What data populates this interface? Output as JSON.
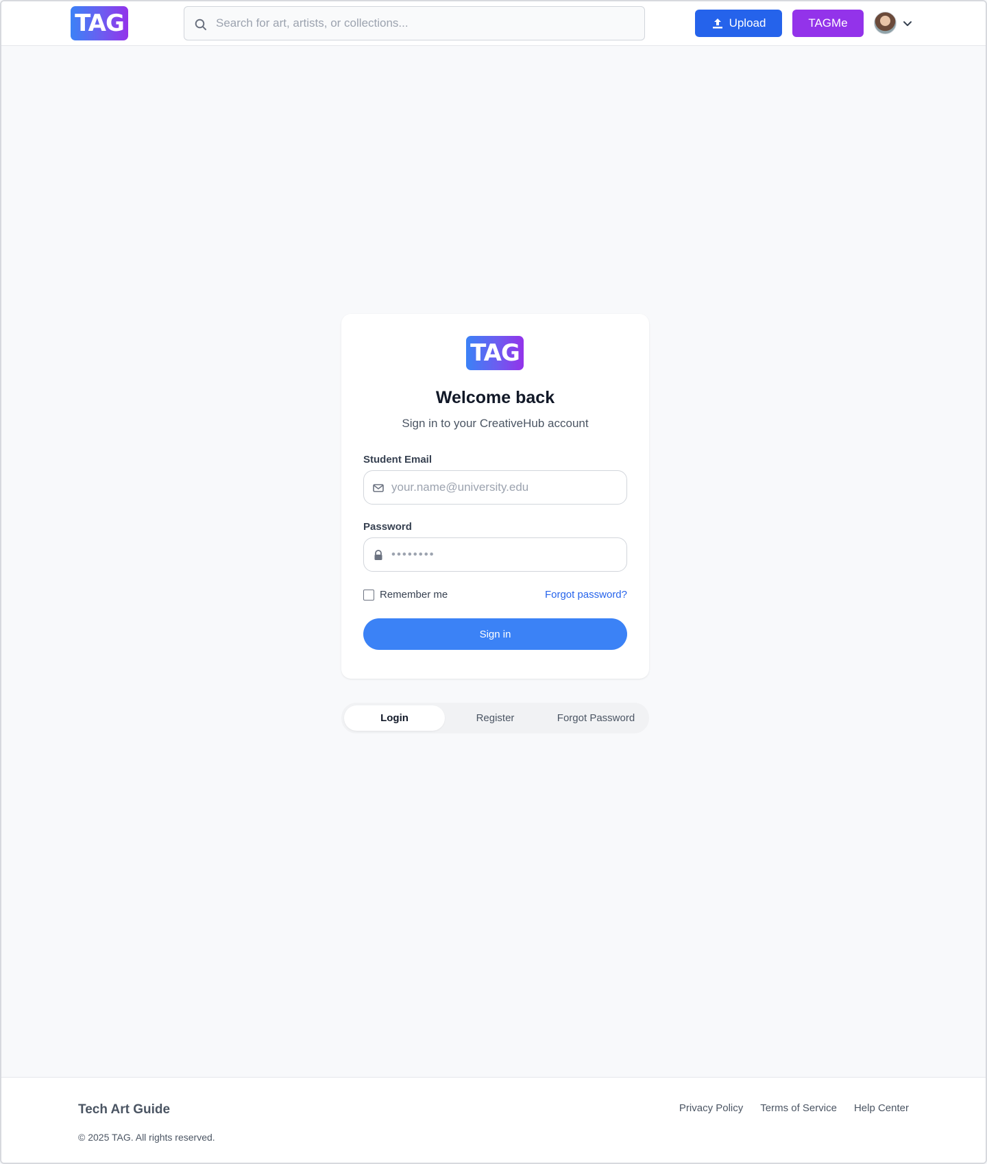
{
  "header": {
    "logo_text": "TAG",
    "search_placeholder": "Search for art, artists, or collections...",
    "upload_label": "Upload",
    "tagme_label": "TAGMe"
  },
  "card": {
    "logo_text": "TAG",
    "title": "Welcome back",
    "subtitle": "Sign in to your CreativeHub account",
    "email_label": "Student Email",
    "email_placeholder": "your.name@university.edu",
    "password_label": "Password",
    "password_value": "••••••••",
    "remember_label": "Remember me",
    "forgot_label": "Forgot password?",
    "signin_label": "Sign in"
  },
  "tabs": [
    {
      "label": "Login",
      "active": true
    },
    {
      "label": "Register",
      "active": false
    },
    {
      "label": "Forgot Password",
      "active": false
    }
  ],
  "footer": {
    "brand": "Tech Art Guide",
    "copyright": "© 2025 TAG. All rights reserved.",
    "links": [
      "Privacy Policy",
      "Terms of Service",
      "Help Center"
    ]
  },
  "colors": {
    "primary": "#3b82f6",
    "upload": "#2563eb",
    "tagme": "#9333ea"
  },
  "icons": [
    "search-icon",
    "upload-icon",
    "chevron-down-icon",
    "mail-icon",
    "lock-icon"
  ]
}
